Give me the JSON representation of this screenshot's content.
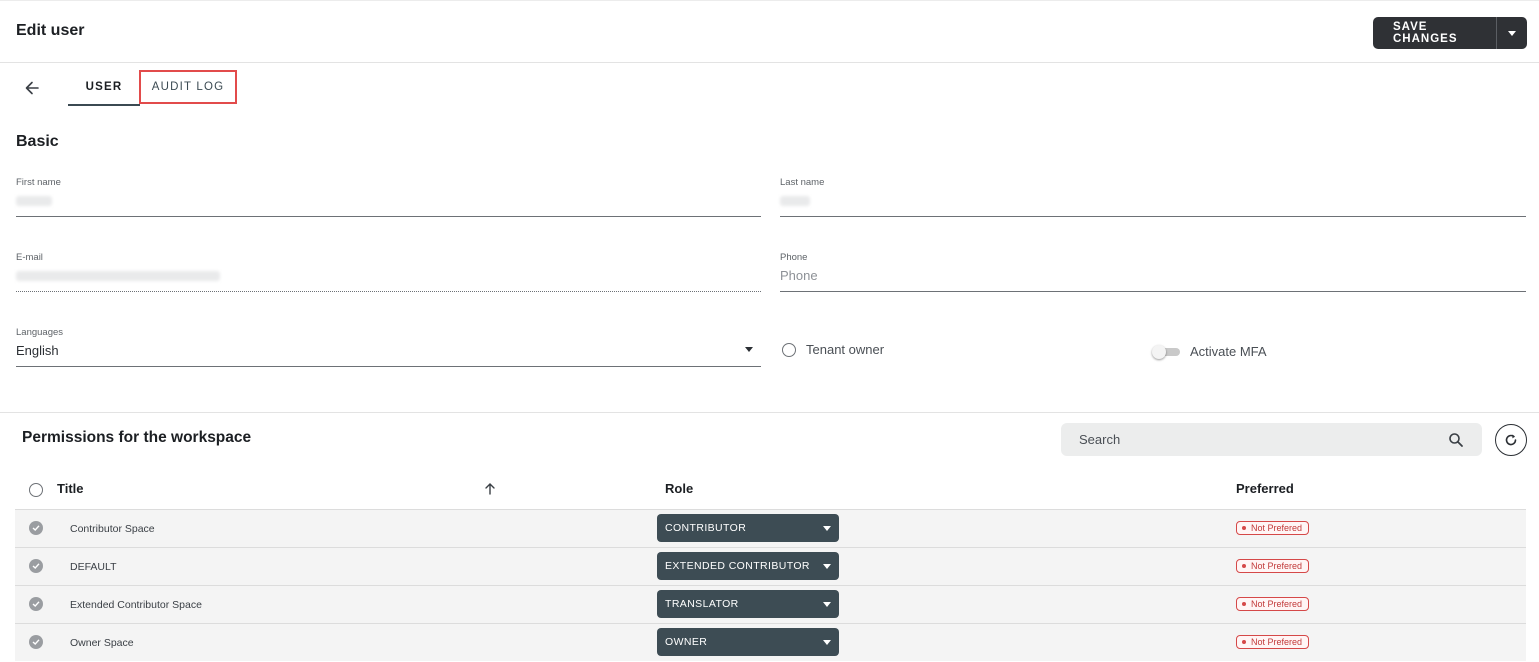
{
  "header": {
    "title": "Edit user",
    "save_label": "SAVE CHANGES"
  },
  "tabs": [
    {
      "label": "USER",
      "active": true
    },
    {
      "label": "AUDIT LOG",
      "active": false,
      "highlighted": true
    }
  ],
  "basic": {
    "section_title": "Basic",
    "first_name": {
      "label": "First name",
      "value": ""
    },
    "last_name": {
      "label": "Last name",
      "value": ""
    },
    "email": {
      "label": "E-mail",
      "value": ""
    },
    "phone": {
      "label": "Phone",
      "placeholder": "Phone",
      "value": ""
    },
    "languages": {
      "label": "Languages",
      "value": "English"
    },
    "tenant_owner": {
      "label": "Tenant owner",
      "checked": false
    },
    "mfa": {
      "label": "Activate MFA",
      "enabled": false
    }
  },
  "permissions": {
    "title": "Permissions for the workspace",
    "search_placeholder": "Search",
    "columns": [
      "Title",
      "Role",
      "Preferred"
    ],
    "rows": [
      {
        "title": "Contributor Space",
        "role": "CONTRIBUTOR",
        "preferred": "Not Prefered"
      },
      {
        "title": "DEFAULT",
        "role": "EXTENDED CONTRIBUTOR",
        "preferred": "Not Prefered"
      },
      {
        "title": "Extended Contributor Space",
        "role": "TRANSLATOR",
        "preferred": "Not Prefered"
      },
      {
        "title": "Owner Space",
        "role": "OWNER",
        "preferred": "Not Prefered"
      }
    ]
  },
  "colors": {
    "primary_dark": "#2f3135",
    "role_select_bg": "#3d4c54",
    "highlight_red": "#e24b4b",
    "badge_red": "#d54848"
  },
  "icons": [
    "back-arrow-icon",
    "chevron-down-icon",
    "search-icon",
    "refresh-icon",
    "sort-up-icon",
    "check-circle-icon"
  ]
}
